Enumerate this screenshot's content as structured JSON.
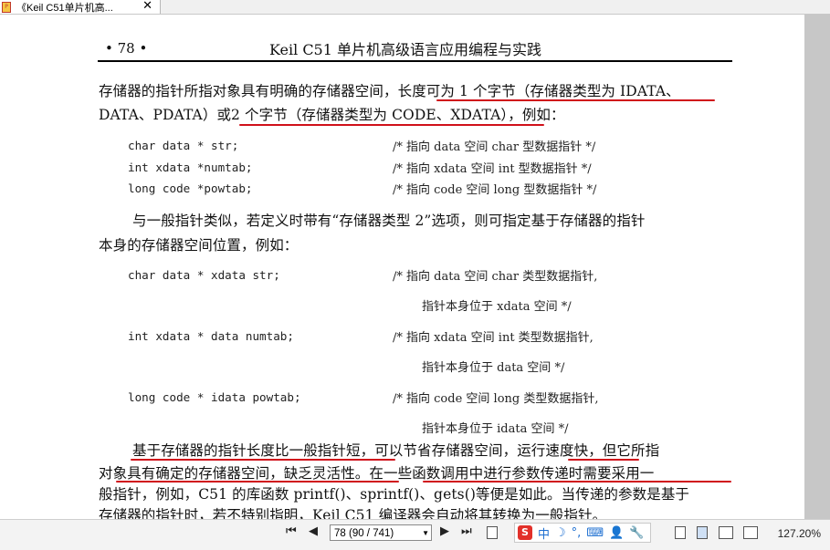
{
  "tab": {
    "title": "《Keil C51单片机高...",
    "close": "✕"
  },
  "page": {
    "number": "• 78 •",
    "header": "Keil C51 单片机高级语言应用编程与实践",
    "p1_l1_a": "存储器的指针所指对象具有明确的存储器空间，",
    "p1_l1_b": "长度可为 1 个字节（存储器类型为 IDATA、",
    "p1_l2_a": "DATA、PDATA）或",
    "p1_l2_b": "2 个字节（存储器类型为 CODE、XDATA）",
    "p1_l2_c": "，例如：",
    "code1": [
      {
        "code": "char data * str;",
        "comment": "/* 指向 data 空间 char 型数据指针 */"
      },
      {
        "code": "int xdata *numtab;",
        "comment": "/* 指向 xdata 空间 int 型数据指针 */"
      },
      {
        "code": "long code *powtab;",
        "comment": "/* 指向 code 空间 long 型数据指针 */"
      }
    ],
    "p2_l1": "与一般指针类似，若定义时带有“存储器类型 2”选项，则可指定基于存储器的指针",
    "p2_l2": "本身的存储器空间位置，例如：",
    "code2": [
      {
        "code": "char data * xdata str;",
        "comment": "/* 指向 data 空间 char 类型数据指针,",
        "comment2": "指针本身位于 xdata 空间 */"
      },
      {
        "code": "int xdata * data numtab;",
        "comment": "/* 指向 xdata 空间 int 类型数据指针,",
        "comment2": "指针本身位于 data 空间 */"
      },
      {
        "code": "long code * idata powtab;",
        "comment": "/* 指向 code 空间 long 类型数据指针,",
        "comment2": "指针本身位于 idata 空间 */"
      }
    ],
    "p3_l1": "基于存储器的指针长度比一般指针短，可以节省存储器空间，运行速度快，但它所指",
    "p3_l2": "对象具有确定的存储器空间，缺乏灵活性。在一些函数调用中进行参数传递时需要采用一",
    "p3_l3": "般指针，例如，C51 的库函数 printf()、sprintf()、gets()等便是如此。当传递的参数是基于",
    "p3_l4": "存储器的指针时，若不特别指明，Keil C51 编译器会自动将其转换为一般指针。"
  },
  "statusbar": {
    "first": "⏮",
    "prev": "◀",
    "page_field": "78 (90 / 741)",
    "next": "▶",
    "last": "⏭",
    "ime_logo": "S",
    "ime_lang": "中",
    "ime_moon": "☽",
    "ime_punct": "°,",
    "ime_keyboard": "⌨",
    "ime_user": "👤",
    "ime_tool": "🔧",
    "zoom": "127.20%"
  },
  "colors": {
    "underline": "#d0101a",
    "background": "#ababab"
  }
}
